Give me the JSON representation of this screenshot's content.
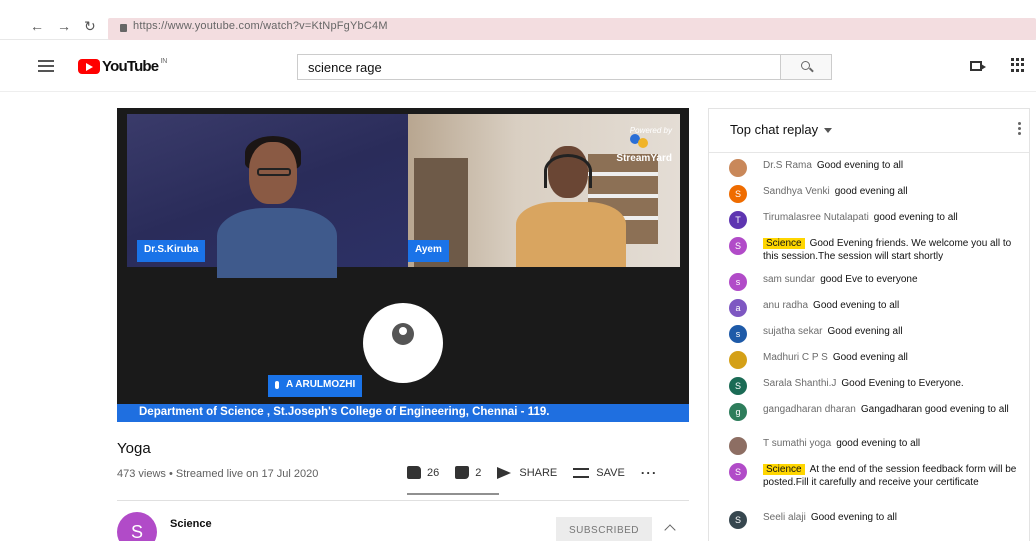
{
  "browser": {
    "back": "←",
    "forward": "→",
    "reload": "↻",
    "url": "https://www.youtube.com/watch?v=KtNpFgYbC4M"
  },
  "header": {
    "logo_text": "YouTube",
    "logo_country": "IN",
    "search_value": "science rage"
  },
  "player": {
    "tile1_name": "Dr.S.Kiruba",
    "tile2_name": "Ayem",
    "tile3_name": "A ARULMOZHI",
    "powered_by": "Powered by",
    "powered_brand": "StreamYard",
    "banner": "Department of Science , St.Joseph's College of Engineering, Chennai - 119."
  },
  "video": {
    "title": "Yoga",
    "meta": "473 views • Streamed live on 17 Jul 2020",
    "likes": "26",
    "dislikes": "2",
    "share_label": "SHARE",
    "save_label": "SAVE",
    "more": "..."
  },
  "channel": {
    "initial": "S",
    "name": "Science",
    "subscribe_label": "SUBSCRIBED"
  },
  "chat": {
    "header": "Top chat replay",
    "messages": [
      {
        "author": "Dr.S Rama",
        "text": "Good evening to all",
        "initial": "",
        "color": "#c9885a",
        "owner": false
      },
      {
        "author": "Sandhya Venki",
        "text": "good evening all",
        "initial": "S",
        "color": "#ef6c00",
        "owner": false
      },
      {
        "author": "Tirumalasree Nutalapati",
        "text": "good evening to all",
        "initial": "T",
        "color": "#5e35b1",
        "owner": false
      },
      {
        "author": "Science",
        "text": "Good Evening friends. We welcome you all to this session.The session will start shortly",
        "initial": "S",
        "color": "#b14bc8",
        "owner": true
      },
      {
        "author": "sam sundar",
        "text": "good Eve to everyone",
        "initial": "s",
        "color": "#b14bc8",
        "owner": false
      },
      {
        "author": "anu radha",
        "text": "Good evening to all",
        "initial": "a",
        "color": "#7e57c2",
        "owner": false
      },
      {
        "author": "sujatha sekar",
        "text": "Good evening all",
        "initial": "s",
        "color": "#1e5aa8",
        "owner": false
      },
      {
        "author": "Madhuri C P S",
        "text": "Good evening all",
        "initial": "",
        "color": "#d4a017",
        "owner": false
      },
      {
        "author": "Sarala Shanthi.J",
        "text": "Good Evening to Everyone.",
        "initial": "S",
        "color": "#1b6b55",
        "owner": false
      },
      {
        "author": "gangadharan dharan",
        "text": "Gangadharan good evening to all",
        "initial": "g",
        "color": "#2e7d5b",
        "owner": false
      },
      {
        "author": "T sumathi yoga",
        "text": "good evening to all",
        "initial": "",
        "color": "#8d6e63",
        "owner": false
      },
      {
        "author": "Science",
        "text": "At the end of the session feedback form will be posted.Fill it carefully and receive your certificate",
        "initial": "S",
        "color": "#b14bc8",
        "owner": true
      },
      {
        "author": "Seeli alaji",
        "text": "Good evening to all",
        "initial": "S",
        "color": "#37474f",
        "owner": false
      }
    ]
  }
}
